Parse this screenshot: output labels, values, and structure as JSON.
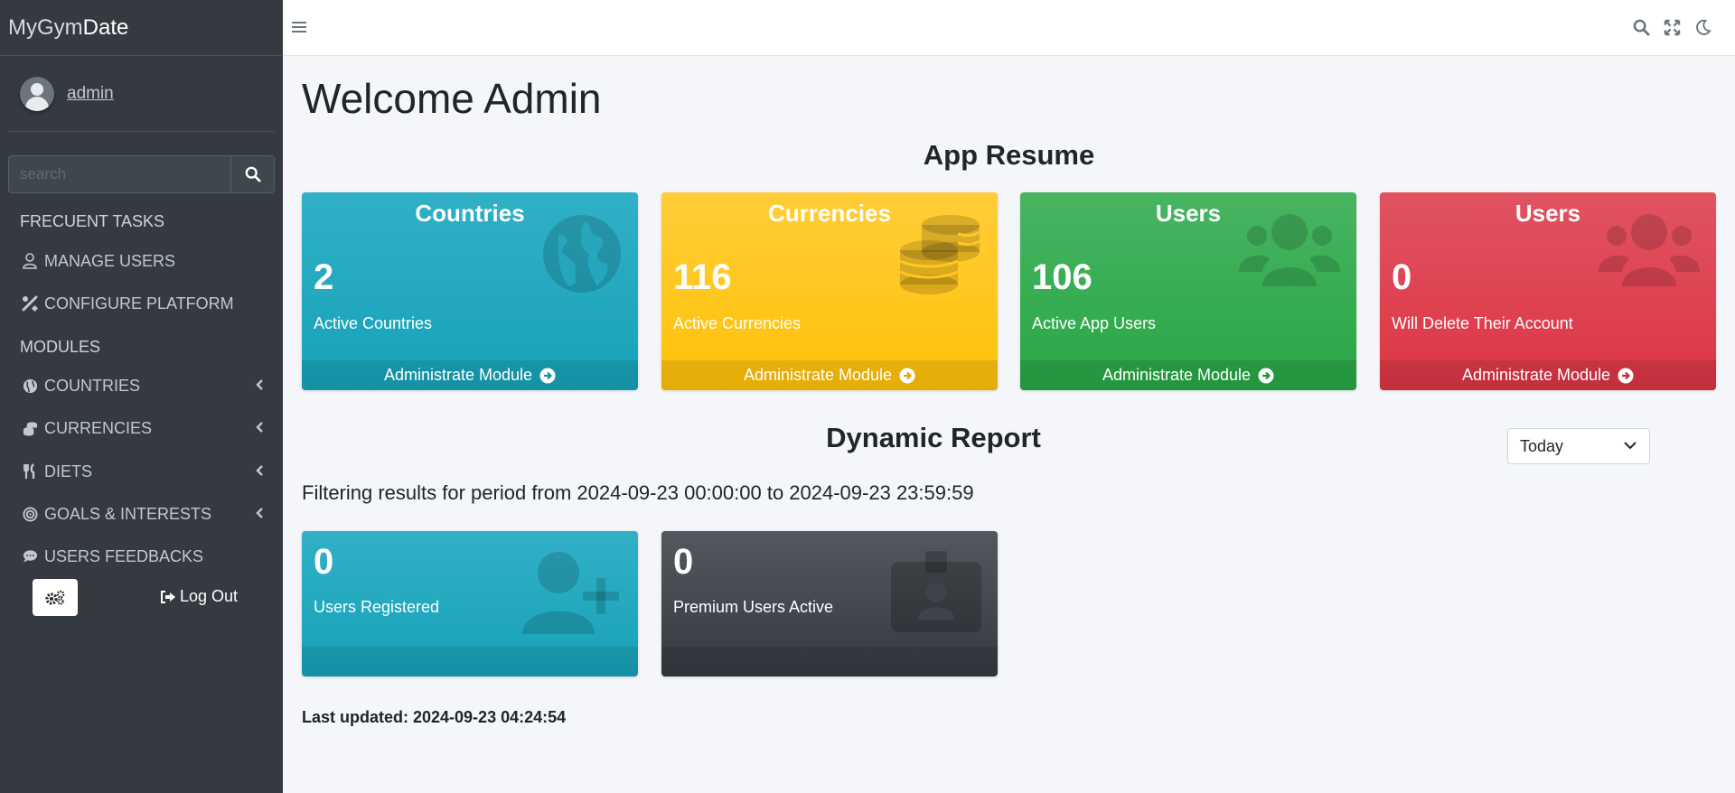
{
  "brand": {
    "part1": "MyGym",
    "part2": "Date"
  },
  "user": {
    "name": "admin"
  },
  "search": {
    "placeholder": "search"
  },
  "sidebar": {
    "header_tasks": "FRECUENT TASKS",
    "header_modules": "MODULES",
    "items": [
      {
        "label": "MANAGE USERS",
        "icon": "user-icon"
      },
      {
        "label": "CONFIGURE PLATFORM",
        "icon": "tools-icon"
      },
      {
        "label": "COUNTRIES",
        "icon": "globe-icon"
      },
      {
        "label": "CURRENCIES",
        "icon": "coins-icon"
      },
      {
        "label": "DIETS",
        "icon": "utensils-icon"
      },
      {
        "label": "GOALS & INTERESTS",
        "icon": "bullseye-icon"
      },
      {
        "label": "USERS FEEDBACKS",
        "icon": "comment-icon"
      }
    ],
    "logout_label": "Log Out"
  },
  "main": {
    "welcome": "Welcome Admin",
    "resume_title": "App Resume",
    "cards": [
      {
        "title": "Countries",
        "value": "2",
        "subtitle": "Active Countries",
        "footer": "Administrate Module",
        "color": "#17a2b8",
        "icon": "globe-icon"
      },
      {
        "title": "Currencies",
        "value": "116",
        "subtitle": "Active Currencies",
        "footer": "Administrate Module",
        "color": "#ffc107",
        "icon": "coins-icon"
      },
      {
        "title": "Users",
        "value": "106",
        "subtitle": "Active App Users",
        "footer": "Administrate Module",
        "color": "#28a745",
        "icon": "users-icon"
      },
      {
        "title": "Users",
        "value": "0",
        "subtitle": "Will Delete Their Account",
        "footer": "Administrate Module",
        "color": "#dc3545",
        "icon": "users-icon"
      }
    ],
    "report_title": "Dynamic Report",
    "period_select": "Today",
    "filter_text": "Filtering results for period from 2024-09-23 00:00:00 to 2024-09-23 23:59:59",
    "report_cards": [
      {
        "value": "0",
        "subtitle": "Users Registered",
        "color": "#17a2b8",
        "icon": "user-plus-icon"
      },
      {
        "value": "0",
        "subtitle": "Premium Users Active",
        "color": "#343a40",
        "icon": "id-badge-icon"
      }
    ],
    "last_updated": "Last updated: 2024-09-23 04:24:54"
  }
}
